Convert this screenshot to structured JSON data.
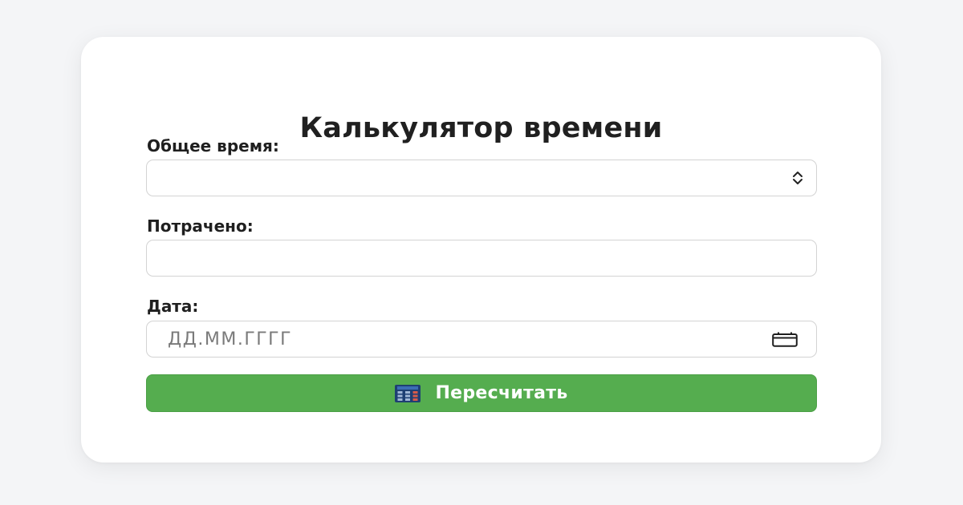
{
  "form": {
    "title": "Калькулятор времени",
    "total_time": {
      "label": "Общее время:",
      "value": "",
      "icon": "spinner-arrows-icon"
    },
    "spent": {
      "label": "Потрачено:",
      "value": ""
    },
    "date": {
      "label": "Дата:",
      "placeholder": "ДД.ММ.ГГГГ",
      "icon": "calendar-icon"
    },
    "submit": {
      "label": "Пересчитать",
      "icon": "calculator-icon"
    }
  },
  "colors": {
    "background": "#f4f5f7",
    "card": "#ffffff",
    "button": "#55ad4f",
    "text": "#1f1f1f",
    "placeholder": "#7a7a7a",
    "field_border": "#d3d3d3"
  }
}
